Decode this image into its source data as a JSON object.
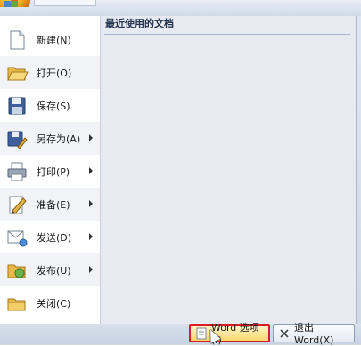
{
  "window": {
    "recent_documents_label": "最近使用的文档"
  },
  "menu": {
    "items": [
      {
        "label": "新建(N)",
        "icon": "new-document-icon",
        "submenu": false
      },
      {
        "label": "打开(O)",
        "icon": "open-folder-icon",
        "submenu": false
      },
      {
        "label": "保存(S)",
        "icon": "save-disk-icon",
        "submenu": false
      },
      {
        "label": "另存为(A)",
        "icon": "save-as-icon",
        "submenu": true
      },
      {
        "label": "打印(P)",
        "icon": "printer-icon",
        "submenu": true
      },
      {
        "label": "准备(E)",
        "icon": "prepare-icon",
        "submenu": true
      },
      {
        "label": "发送(D)",
        "icon": "send-icon",
        "submenu": true
      },
      {
        "label": "发布(U)",
        "icon": "publish-icon",
        "submenu": true
      },
      {
        "label": "关闭(C)",
        "icon": "close-folder-icon",
        "submenu": false
      }
    ]
  },
  "buttons": {
    "word_options": "Word 选项(I)",
    "exit_word": "退出 Word(X)"
  },
  "colors": {
    "highlight_border": "#d81e24",
    "orb": "#f3a81f"
  }
}
